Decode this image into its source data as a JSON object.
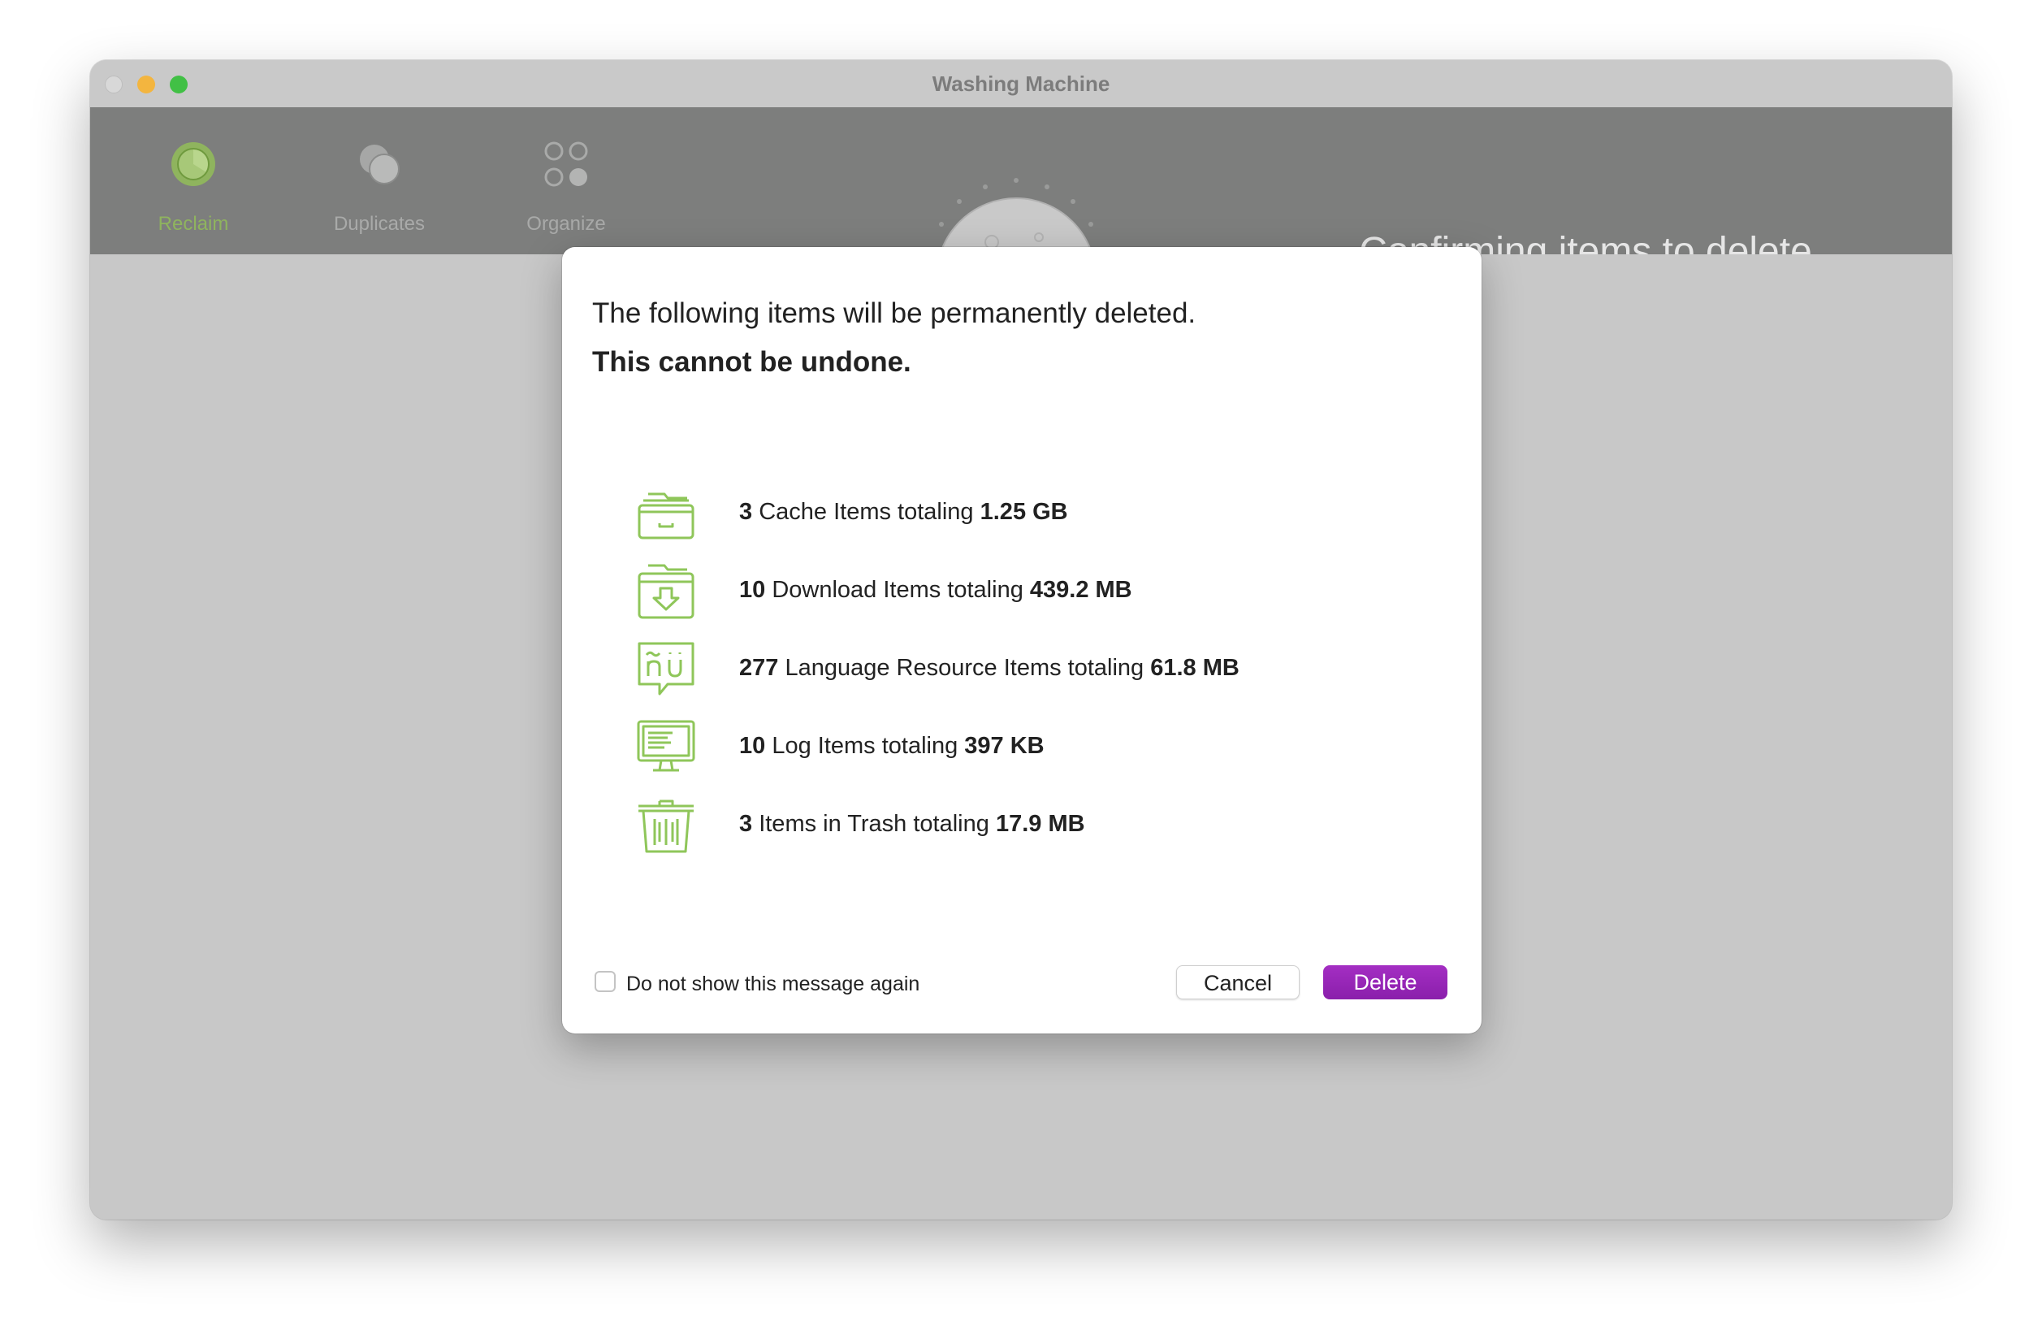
{
  "window": {
    "title": "Washing Machine"
  },
  "toolbar": {
    "tabs": [
      {
        "label": "Reclaim",
        "icon": "pie-chart-icon",
        "active": true
      },
      {
        "label": "Duplicates",
        "icon": "overlapping-circles-icon",
        "active": false
      },
      {
        "label": "Organize",
        "icon": "four-dots-icon",
        "active": false
      }
    ],
    "status": "Confirming items to delete…",
    "progress": 0.97
  },
  "dialog": {
    "title": "The following items will be permanently deleted.",
    "warning": "This cannot be undone.",
    "items": [
      {
        "icon": "cache-drawer-icon",
        "count": "3",
        "label": " Cache Items totaling ",
        "size": "1.25 GB"
      },
      {
        "icon": "download-folder-icon",
        "count": "10",
        "label": " Download Items totaling ",
        "size": "439.2 MB"
      },
      {
        "icon": "language-resource-icon",
        "count": "277",
        "label": " Language Resource Items totaling ",
        "size": "61.8 MB"
      },
      {
        "icon": "log-monitor-icon",
        "count": "10",
        "label": " Log Items totaling ",
        "size": "397 KB"
      },
      {
        "icon": "trash-can-icon",
        "count": "3",
        "label": " Items in Trash totaling ",
        "size": "17.9 MB"
      }
    ],
    "checkbox_label": "Do not show this message again",
    "checkbox_checked": false,
    "cancel_label": "Cancel",
    "delete_label": "Delete"
  },
  "colors": {
    "accent_green": "#8fc65a",
    "delete_purple": "#9a27bd",
    "toolbar_gray": "#7d7e7d",
    "progress_blue": "#9fc0de"
  }
}
